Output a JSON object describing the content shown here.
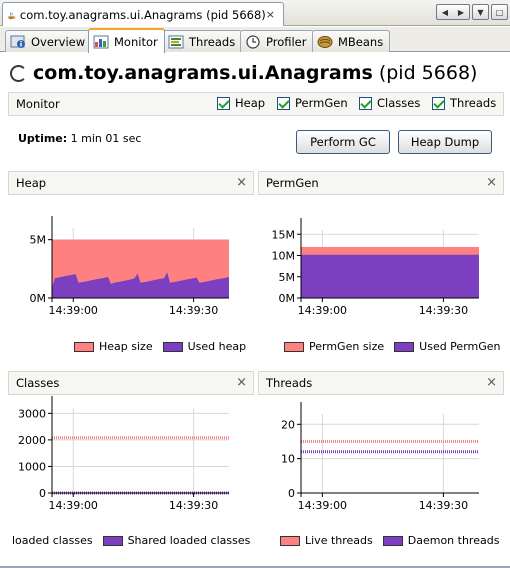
{
  "window": {
    "doc_tab_label": "com.toy.anagrams.ui.Anagrams (pid 5668)",
    "doc_tab_close": "×",
    "nav_buttons": [
      "◀",
      "▶"
    ],
    "dropdown_button": "▼",
    "restore_button": "□"
  },
  "subtabs": [
    {
      "label": "Overview",
      "icon": "info-icon"
    },
    {
      "label": "Monitor",
      "icon": "monitor-chart-icon"
    },
    {
      "label": "Threads",
      "icon": "threads-icon"
    },
    {
      "label": "Profiler",
      "icon": "profiler-clock-icon"
    },
    {
      "label": "MBeans",
      "icon": "mbeans-icon"
    }
  ],
  "header": {
    "app_name": "com.toy.anagrams.ui.Anagrams",
    "pid": "(pid 5668)"
  },
  "monitor_bar": {
    "label": "Monitor",
    "checkboxes": [
      {
        "label": "Heap",
        "checked": true
      },
      {
        "label": "PermGen",
        "checked": true
      },
      {
        "label": "Classes",
        "checked": true
      },
      {
        "label": "Threads",
        "checked": true
      }
    ]
  },
  "uptime": {
    "label": "Uptime:",
    "value": "1 min 01 sec"
  },
  "buttons": {
    "perform_gc": "Perform GC",
    "heap_dump": "Heap Dump"
  },
  "panels": {
    "heap": {
      "title": "Heap",
      "close": "×"
    },
    "permgen": {
      "title": "PermGen",
      "close": "×"
    },
    "classes": {
      "title": "Classes",
      "close": "×"
    },
    "threads": {
      "title": "Threads",
      "close": "×"
    }
  },
  "colors": {
    "size_series": "#ff8080",
    "used_series": "#7b3fbf",
    "axis": "#000000",
    "grid": "#d8d8d8"
  },
  "chart_data": [
    {
      "type": "area",
      "id": "heap",
      "x_ticks": [
        "14:39:00",
        "14:39:30"
      ],
      "y_ticks": [
        "0M",
        "5M"
      ],
      "ylim": [
        0,
        6
      ],
      "unit": "M",
      "series": [
        {
          "name": "Heap size",
          "color": "#ff8080",
          "values": [
            5,
            5,
            5,
            5,
            5,
            5,
            5,
            5,
            5,
            5,
            5,
            5,
            5,
            5,
            5,
            5,
            5,
            5,
            5,
            5,
            5,
            5,
            5,
            5,
            5,
            5,
            5,
            5,
            5,
            5,
            5,
            5,
            5,
            5,
            5,
            5,
            5,
            5,
            5,
            5,
            5,
            5,
            5,
            5,
            5,
            5,
            5,
            5,
            5,
            5,
            5,
            5,
            5,
            5,
            5,
            5,
            5,
            5,
            5,
            5,
            5
          ]
        },
        {
          "name": "Used heap",
          "color": "#7b3fbf",
          "values": [
            0.9,
            1.7,
            1.75,
            1.8,
            1.85,
            1.9,
            1.95,
            2.0,
            2.05,
            1.3,
            1.35,
            1.4,
            1.45,
            1.5,
            1.55,
            1.6,
            1.65,
            1.7,
            1.75,
            1.8,
            1.2,
            1.3,
            1.35,
            1.4,
            1.45,
            1.5,
            1.55,
            1.6,
            1.7,
            2.1,
            1.3,
            1.35,
            1.4,
            1.45,
            1.5,
            1.55,
            1.6,
            1.65,
            1.7,
            2.2,
            1.3,
            1.35,
            1.4,
            1.45,
            1.5,
            1.55,
            1.6,
            1.65,
            1.7,
            1.75,
            1.3,
            1.35,
            1.4,
            1.45,
            1.5,
            1.55,
            1.6,
            1.65,
            1.7,
            1.75,
            1.8
          ]
        }
      ]
    },
    {
      "type": "area",
      "id": "permgen",
      "x_ticks": [
        "14:39:00",
        "14:39:30"
      ],
      "y_ticks": [
        "0M",
        "5M",
        "10M",
        "15M"
      ],
      "ylim": [
        0,
        16
      ],
      "unit": "M",
      "series": [
        {
          "name": "PermGen size",
          "color": "#ff8080",
          "values": [
            12,
            12,
            12,
            12,
            12,
            12,
            12,
            12,
            12,
            12,
            12
          ]
        },
        {
          "name": "Used PermGen",
          "color": "#7b3fbf",
          "values": [
            10.2,
            10.2,
            10.2,
            10.2,
            10.2,
            10.2,
            10.2,
            10.2,
            10.2,
            10.2,
            10.2
          ]
        }
      ]
    },
    {
      "type": "line",
      "id": "classes",
      "x_ticks": [
        "14:39:00",
        "14:39:30"
      ],
      "y_ticks": [
        "0",
        "1000",
        "2000",
        "3000"
      ],
      "ylim": [
        0,
        3200
      ],
      "series": [
        {
          "name": "loaded classes",
          "color": "#ff8080",
          "values": [
            2080,
            2080,
            2080,
            2080,
            2080,
            2080,
            2080,
            2080,
            2080,
            2080,
            2080
          ]
        },
        {
          "name": "Shared loaded classes",
          "color": "#7b3fbf",
          "values": [
            0,
            0,
            0,
            0,
            0,
            0,
            0,
            0,
            0,
            0,
            0
          ]
        }
      ]
    },
    {
      "type": "line",
      "id": "threads",
      "x_ticks": [
        "14:39:00",
        "14:39:30"
      ],
      "y_ticks": [
        "0",
        "10",
        "20"
      ],
      "ylim": [
        0,
        23
      ],
      "series": [
        {
          "name": "Live threads",
          "color": "#ff8080",
          "values": [
            15,
            15,
            15,
            15,
            15,
            15,
            15,
            15,
            15,
            15,
            15
          ]
        },
        {
          "name": "Daemon threads",
          "color": "#7b3fbf",
          "values": [
            12,
            12,
            12,
            12,
            12,
            12,
            12,
            12,
            12,
            12,
            12
          ]
        }
      ]
    }
  ]
}
